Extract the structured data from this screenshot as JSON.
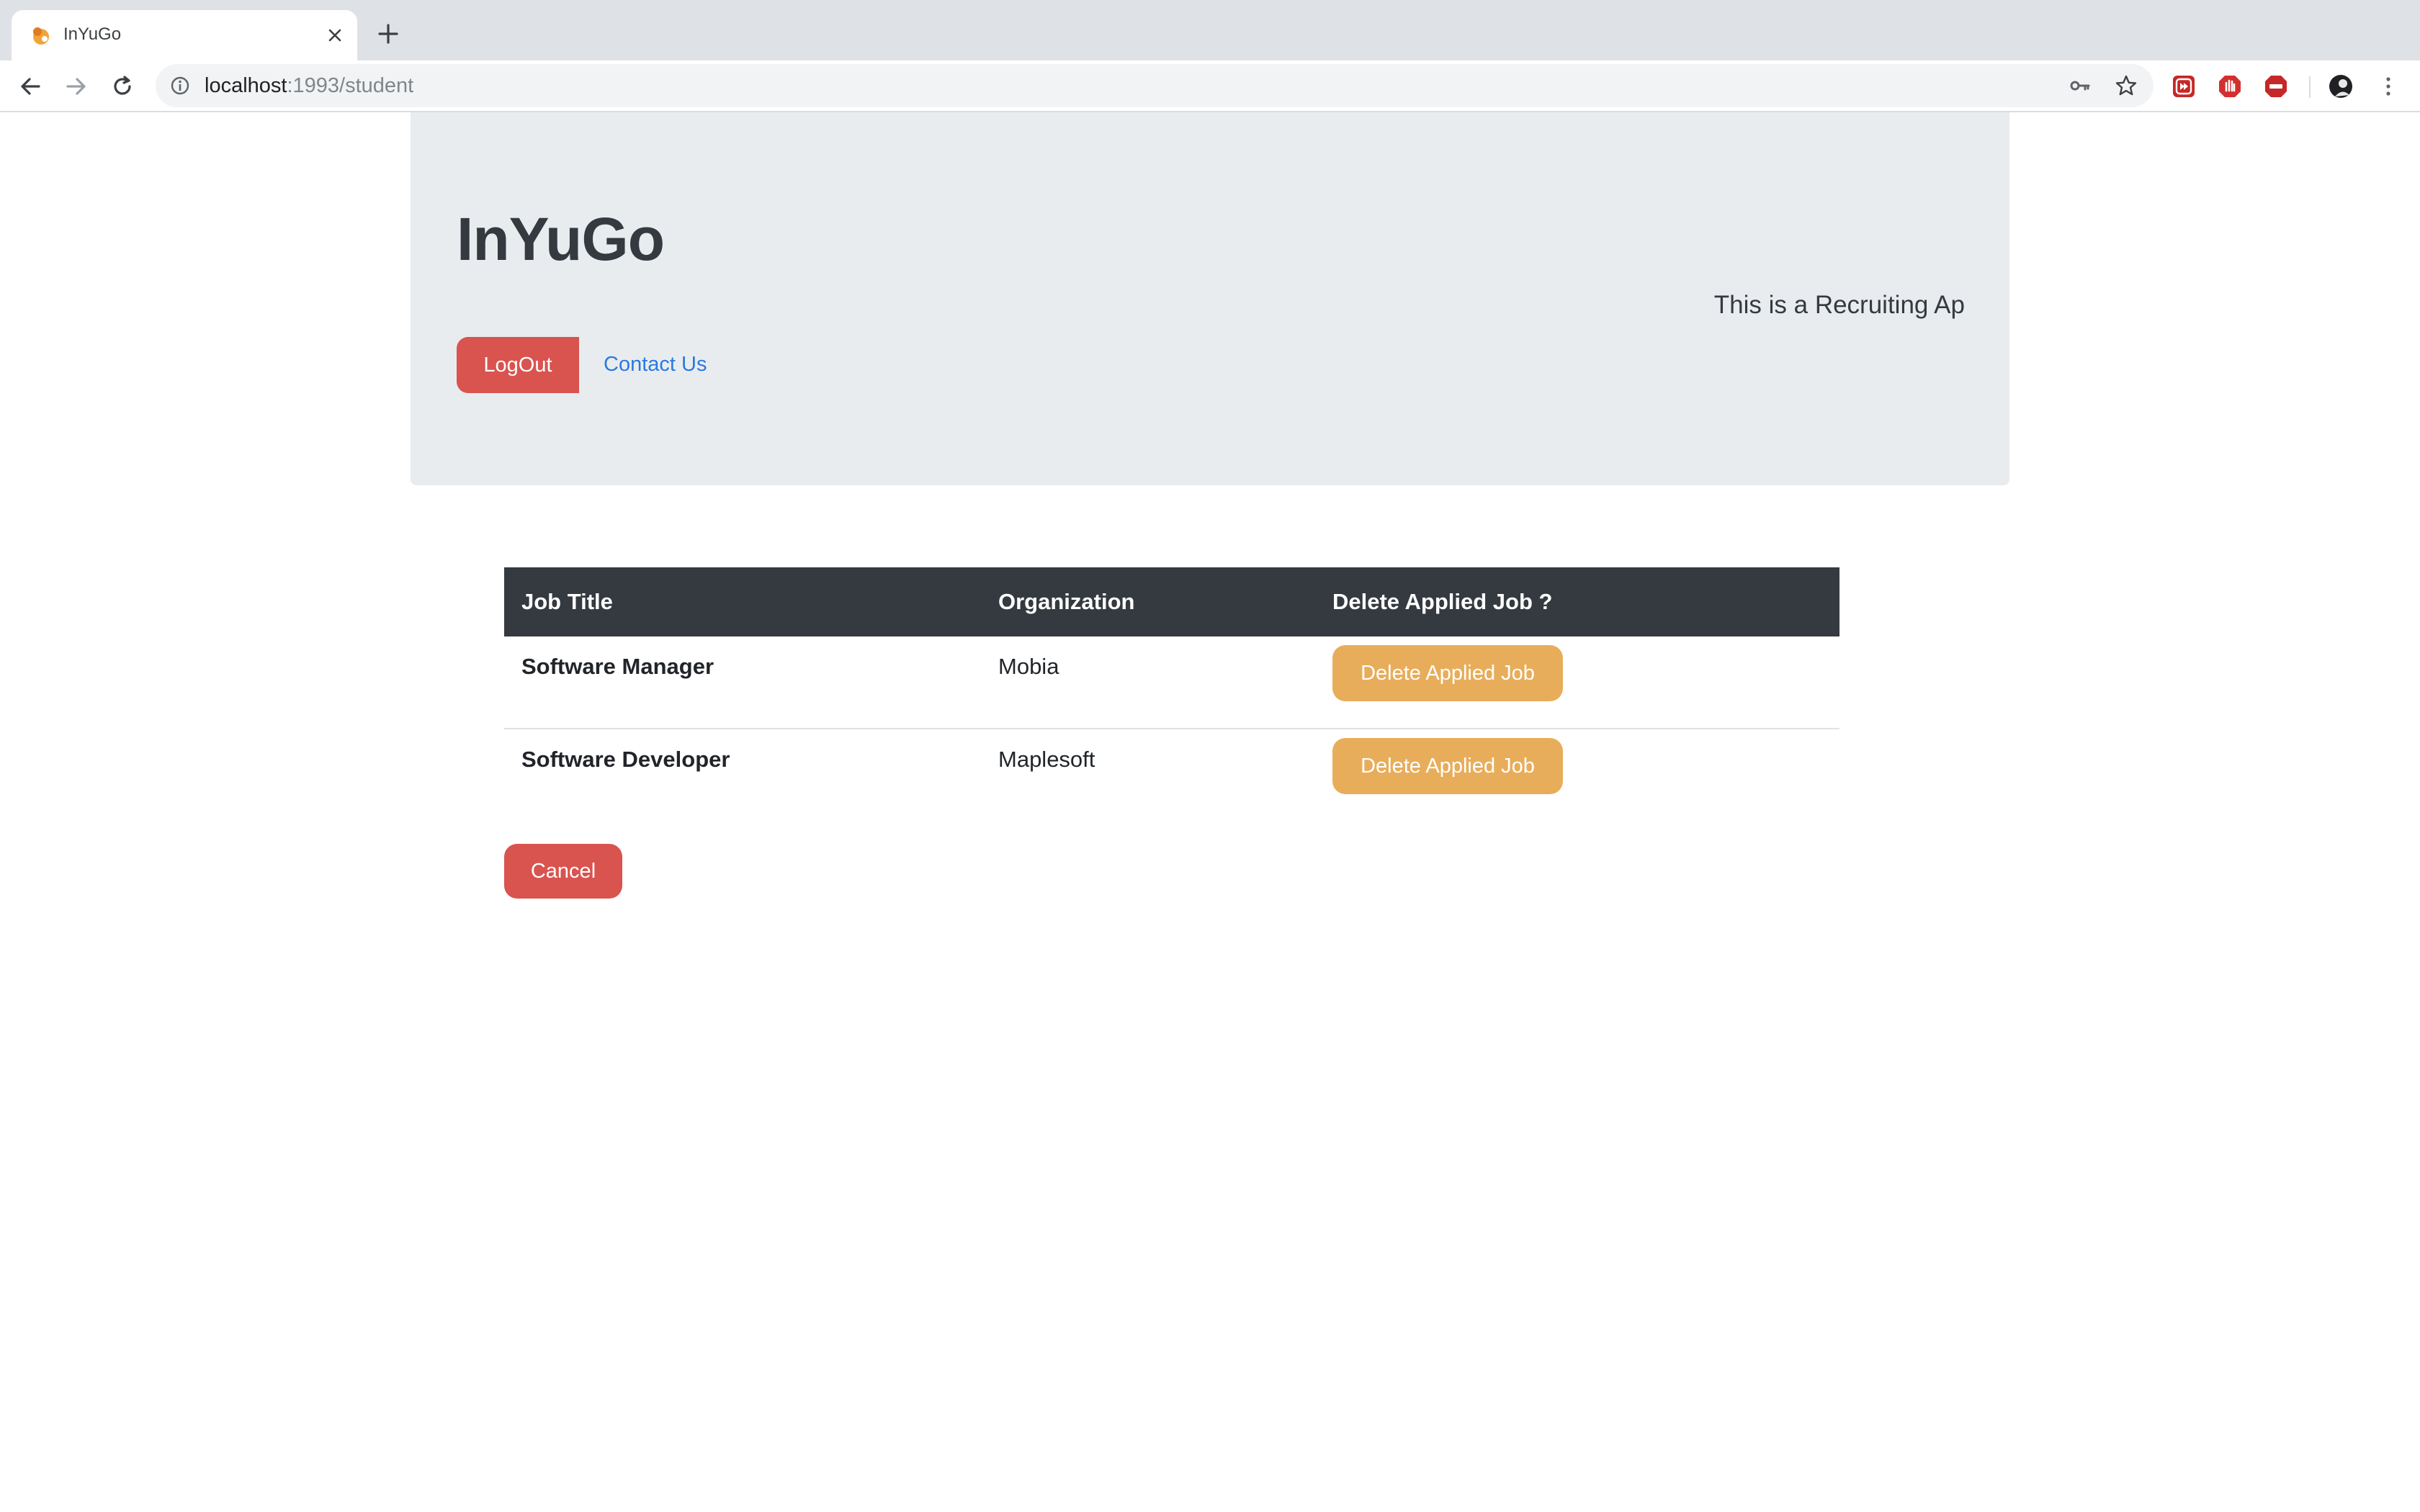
{
  "browser": {
    "tab_title": "InYuGo",
    "url_host": "localhost",
    "url_path": ":1993/student"
  },
  "header": {
    "brand": "InYuGo",
    "tagline": "This is a Recruiting Ap",
    "logout_label": "LogOut",
    "contact_label": "Contact Us"
  },
  "table": {
    "columns": [
      "Job Title",
      "Organization",
      "Delete Applied Job ?"
    ],
    "rows": [
      {
        "job_title": "Software Manager",
        "organization": "Mobia",
        "action_label": "Delete Applied Job"
      },
      {
        "job_title": "Software Developer",
        "organization": "Maplesoft",
        "action_label": "Delete Applied Job"
      }
    ]
  },
  "cancel_label": "Cancel",
  "colors": {
    "danger": "#d9534f",
    "warning": "#e8ad5a",
    "table_header": "#343a40",
    "jumbotron": "#e9ecef",
    "link": "#2a7ae2"
  }
}
